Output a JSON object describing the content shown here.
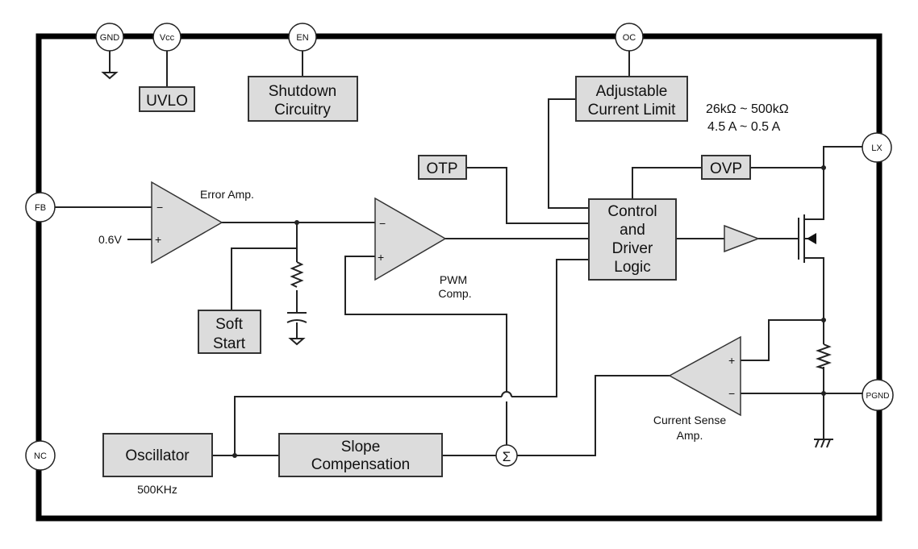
{
  "pins": {
    "gnd": "GND",
    "vcc": "Vcc",
    "en": "EN",
    "oc": "OC",
    "lx": "LX",
    "fb": "FB",
    "nc": "NC",
    "pgnd": "PGND"
  },
  "blocks": {
    "uvlo": "UVLO",
    "shutdown_1": "Shutdown",
    "shutdown_2": "Circuitry",
    "adj_1": "Adjustable",
    "adj_2": "Current Limit",
    "otp": "OTP",
    "ovp": "OVP",
    "ctrl_1": "Control",
    "ctrl_2": "and",
    "ctrl_3": "Driver",
    "ctrl_4": "Logic",
    "soft_1": "Soft",
    "soft_2": "Start",
    "osc": "Oscillator",
    "slope_1": "Slope",
    "slope_2": "Compensation"
  },
  "labels": {
    "res_range": "26kΩ ~ 500kΩ",
    "cur_range": "4.5 A ~ 0.5 A",
    "error_amp": "Error Amp.",
    "vref": "0.6V",
    "pwm_1": "PWM",
    "pwm_2": "Comp.",
    "cs_1": "Current Sense",
    "cs_2": "Amp.",
    "freq": "500KHz",
    "sigma": "Σ",
    "minus": "−",
    "plus": "+"
  }
}
